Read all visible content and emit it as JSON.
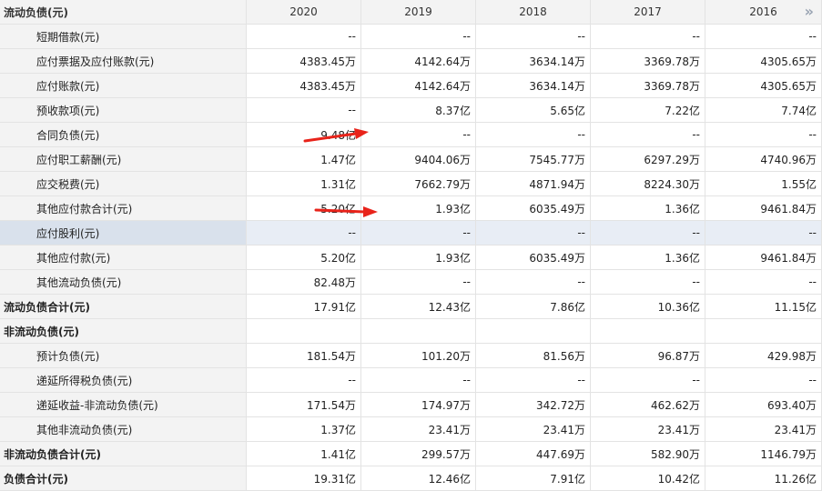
{
  "header": {
    "title": "流动负债(元)",
    "years": [
      "2020",
      "2019",
      "2018",
      "2017",
      "2016"
    ]
  },
  "rows": [
    {
      "label": "短期借款(元)",
      "bold": false,
      "values": [
        "--",
        "--",
        "--",
        "--",
        "--"
      ]
    },
    {
      "label": "应付票据及应付账款(元)",
      "bold": false,
      "values": [
        "4383.45万",
        "4142.64万",
        "3634.14万",
        "3369.78万",
        "4305.65万"
      ]
    },
    {
      "label": "应付账款(元)",
      "bold": false,
      "values": [
        "4383.45万",
        "4142.64万",
        "3634.14万",
        "3369.78万",
        "4305.65万"
      ]
    },
    {
      "label": "预收款项(元)",
      "bold": false,
      "values": [
        "--",
        "8.37亿",
        "5.65亿",
        "7.22亿",
        "7.74亿"
      ]
    },
    {
      "label": "合同负债(元)",
      "bold": false,
      "values": [
        "9.48亿",
        "--",
        "--",
        "--",
        "--"
      ]
    },
    {
      "label": "应付职工薪酬(元)",
      "bold": false,
      "values": [
        "1.47亿",
        "9404.06万",
        "7545.77万",
        "6297.29万",
        "4740.96万"
      ]
    },
    {
      "label": "应交税费(元)",
      "bold": false,
      "values": [
        "1.31亿",
        "7662.79万",
        "4871.94万",
        "8224.30万",
        "1.55亿"
      ]
    },
    {
      "label": "其他应付款合计(元)",
      "bold": false,
      "values": [
        "5.20亿",
        "1.93亿",
        "6035.49万",
        "1.36亿",
        "9461.84万"
      ]
    },
    {
      "label": "应付股利(元)",
      "bold": false,
      "highlight": true,
      "values": [
        "--",
        "--",
        "--",
        "--",
        "--"
      ]
    },
    {
      "label": "其他应付款(元)",
      "bold": false,
      "values": [
        "5.20亿",
        "1.93亿",
        "6035.49万",
        "1.36亿",
        "9461.84万"
      ]
    },
    {
      "label": "其他流动负债(元)",
      "bold": false,
      "values": [
        "82.48万",
        "--",
        "--",
        "--",
        "--"
      ]
    },
    {
      "label": "流动负债合计(元)",
      "bold": true,
      "values": [
        "17.91亿",
        "12.43亿",
        "7.86亿",
        "10.36亿",
        "11.15亿"
      ]
    },
    {
      "label": "非流动负债(元)",
      "bold": true,
      "values": [
        "",
        "",
        "",
        "",
        ""
      ]
    },
    {
      "label": "预计负债(元)",
      "bold": false,
      "values": [
        "181.54万",
        "101.20万",
        "81.56万",
        "96.87万",
        "429.98万"
      ]
    },
    {
      "label": "递延所得税负债(元)",
      "bold": false,
      "values": [
        "--",
        "--",
        "--",
        "--",
        "--"
      ]
    },
    {
      "label": "递延收益-非流动负债(元)",
      "bold": false,
      "values": [
        "171.54万",
        "174.97万",
        "342.72万",
        "462.62万",
        "693.40万"
      ]
    },
    {
      "label": "其他非流动负债(元)",
      "bold": false,
      "values": [
        "1.37亿",
        "23.41万",
        "23.41万",
        "23.41万",
        "23.41万"
      ]
    },
    {
      "label": "非流动负债合计(元)",
      "bold": true,
      "values": [
        "1.41亿",
        "299.57万",
        "447.69万",
        "582.90万",
        "1146.79万"
      ]
    },
    {
      "label": "负债合计(元)",
      "bold": true,
      "values": [
        "19.31亿",
        "12.46亿",
        "7.91亿",
        "10.42亿",
        "11.26亿"
      ]
    }
  ],
  "icons": {
    "more": "double-chevron-right-icon",
    "arrow": "red-arrow-icon"
  },
  "colors": {
    "arrow": "#e8231a",
    "label_bg": "#f3f3f3",
    "highlight_bg": "#e8edf5"
  }
}
